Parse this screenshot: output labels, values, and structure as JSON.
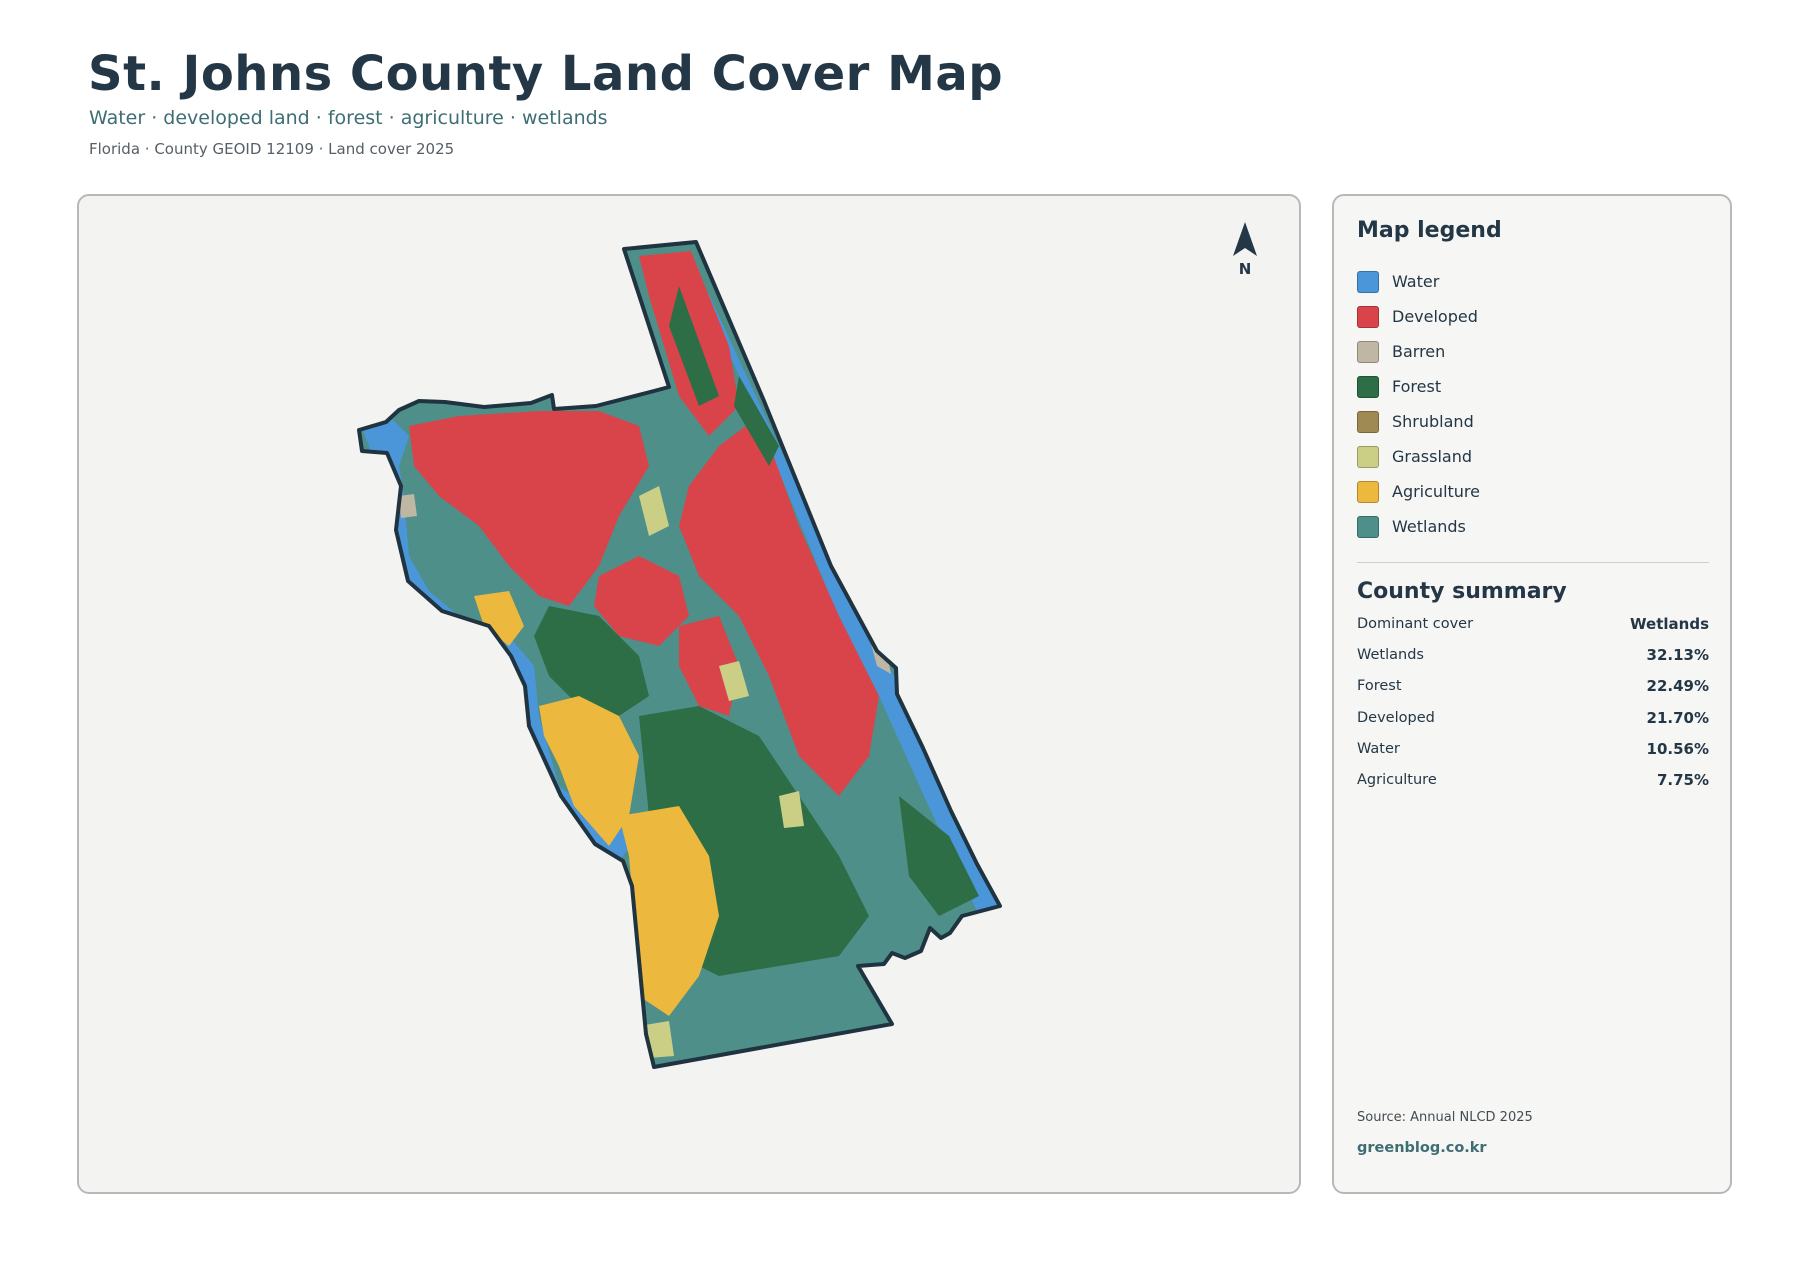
{
  "header": {
    "title": "St. Johns County Land Cover Map",
    "subtitle": "Water · developed land · forest · agriculture · wetlands",
    "meta": "Florida · County GEOID 12109 · Land cover 2025"
  },
  "map": {
    "north_label": "N",
    "colors": {
      "water": "#4a96d8",
      "developed": "#d9444a",
      "barren": "#bfb7a3",
      "forest": "#2d6e46",
      "shrubland": "#a08a54",
      "grassland": "#cbcf85",
      "agriculture": "#ecb83e",
      "wetlands": "#4e8f89",
      "boundary": "#1f3340",
      "panel_background": "#f3f3f1"
    }
  },
  "legend": {
    "heading": "Map legend",
    "items": [
      {
        "label": "Water",
        "color": "#4a96d8"
      },
      {
        "label": "Developed",
        "color": "#d9444a"
      },
      {
        "label": "Barren",
        "color": "#bfb7a3"
      },
      {
        "label": "Forest",
        "color": "#2d6e46"
      },
      {
        "label": "Shrubland",
        "color": "#a08a54"
      },
      {
        "label": "Grassland",
        "color": "#cbcf85"
      },
      {
        "label": "Agriculture",
        "color": "#ecb83e"
      },
      {
        "label": "Wetlands",
        "color": "#4e8f89"
      }
    ]
  },
  "summary": {
    "heading": "County summary",
    "rows": [
      {
        "key": "Dominant cover",
        "value": "Wetlands"
      },
      {
        "key": "Wetlands",
        "value": "32.13%"
      },
      {
        "key": "Forest",
        "value": "22.49%"
      },
      {
        "key": "Developed",
        "value": "21.70%"
      },
      {
        "key": "Water",
        "value": "10.56%"
      },
      {
        "key": "Agriculture",
        "value": "7.75%"
      }
    ]
  },
  "footer": {
    "source": "Source: Annual NLCD 2025",
    "credit": "greenblog.co.kr"
  }
}
